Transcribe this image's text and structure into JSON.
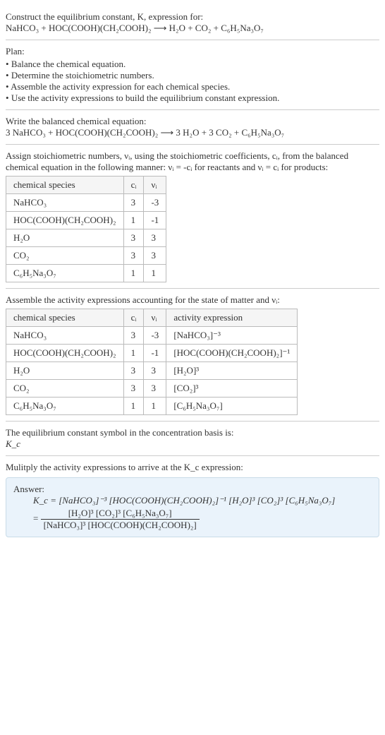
{
  "s1": {
    "intro": "Construct the equilibrium constant, K, expression for:",
    "eq": "NaHCO₃ + HOC(COOH)(CH₂COOH)₂  ⟶  H₂O + CO₂ + C₆H₅Na₃O₇"
  },
  "s2": {
    "heading": "Plan:",
    "items": [
      "Balance the chemical equation.",
      "Determine the stoichiometric numbers.",
      "Assemble the activity expression for each chemical species.",
      "Use the activity expressions to build the equilibrium constant expression."
    ]
  },
  "s3": {
    "heading": "Write the balanced chemical equation:",
    "eq": "3 NaHCO₃ + HOC(COOH)(CH₂COOH)₂  ⟶  3 H₂O + 3 CO₂ + C₆H₅Na₃O₇"
  },
  "s4": {
    "intro": "Assign stoichiometric numbers, νᵢ, using the stoichiometric coefficients, cᵢ, from the balanced chemical equation in the following manner: νᵢ = -cᵢ for reactants and νᵢ = cᵢ for products:",
    "headers": [
      "chemical species",
      "cᵢ",
      "νᵢ"
    ],
    "rows": [
      [
        "NaHCO₃",
        "3",
        "-3"
      ],
      [
        "HOC(COOH)(CH₂COOH)₂",
        "1",
        "-1"
      ],
      [
        "H₂O",
        "3",
        "3"
      ],
      [
        "CO₂",
        "3",
        "3"
      ],
      [
        "C₆H₅Na₃O₇",
        "1",
        "1"
      ]
    ]
  },
  "s5": {
    "intro": "Assemble the activity expressions accounting for the state of matter and νᵢ:",
    "headers": [
      "chemical species",
      "cᵢ",
      "νᵢ",
      "activity expression"
    ],
    "rows": [
      [
        "NaHCO₃",
        "3",
        "-3",
        "[NaHCO₃]⁻³"
      ],
      [
        "HOC(COOH)(CH₂COOH)₂",
        "1",
        "-1",
        "[HOC(COOH)(CH₂COOH)₂]⁻¹"
      ],
      [
        "H₂O",
        "3",
        "3",
        "[H₂O]³"
      ],
      [
        "CO₂",
        "3",
        "3",
        "[CO₂]³"
      ],
      [
        "C₆H₅Na₃O₇",
        "1",
        "1",
        "[C₆H₅Na₃O₇]"
      ]
    ]
  },
  "s6": {
    "line1": "The equilibrium constant symbol in the concentration basis is:",
    "line2": "K_c"
  },
  "s7": {
    "intro": "Mulitply the activity expressions to arrive at the K_c expression:"
  },
  "answer": {
    "label": "Answer:",
    "line1": "K_c = [NaHCO₃]⁻³ [HOC(COOH)(CH₂COOH)₂]⁻¹ [H₂O]³ [CO₂]³ [C₆H₅Na₃O₇]",
    "frac_num": "[H₂O]³ [CO₂]³ [C₆H₅Na₃O₇]",
    "frac_den": "[NaHCO₃]³ [HOC(COOH)(CH₂COOH)₂]",
    "eq_prefix": "= "
  },
  "chart_data": {
    "type": "table",
    "tables": [
      {
        "title": "stoichiometric numbers",
        "columns": [
          "chemical species",
          "c_i",
          "nu_i"
        ],
        "rows": [
          [
            "NaHCO3",
            3,
            -3
          ],
          [
            "HOC(COOH)(CH2COOH)2",
            1,
            -1
          ],
          [
            "H2O",
            3,
            3
          ],
          [
            "CO2",
            3,
            3
          ],
          [
            "C6H5Na3O7",
            1,
            1
          ]
        ]
      },
      {
        "title": "activity expressions",
        "columns": [
          "chemical species",
          "c_i",
          "nu_i",
          "activity expression"
        ],
        "rows": [
          [
            "NaHCO3",
            3,
            -3,
            "[NaHCO3]^-3"
          ],
          [
            "HOC(COOH)(CH2COOH)2",
            1,
            -1,
            "[HOC(COOH)(CH2COOH)2]^-1"
          ],
          [
            "H2O",
            3,
            3,
            "[H2O]^3"
          ],
          [
            "CO2",
            3,
            3,
            "[CO2]^3"
          ],
          [
            "C6H5Na3O7",
            1,
            1,
            "[C6H5Na3O7]"
          ]
        ]
      }
    ]
  }
}
